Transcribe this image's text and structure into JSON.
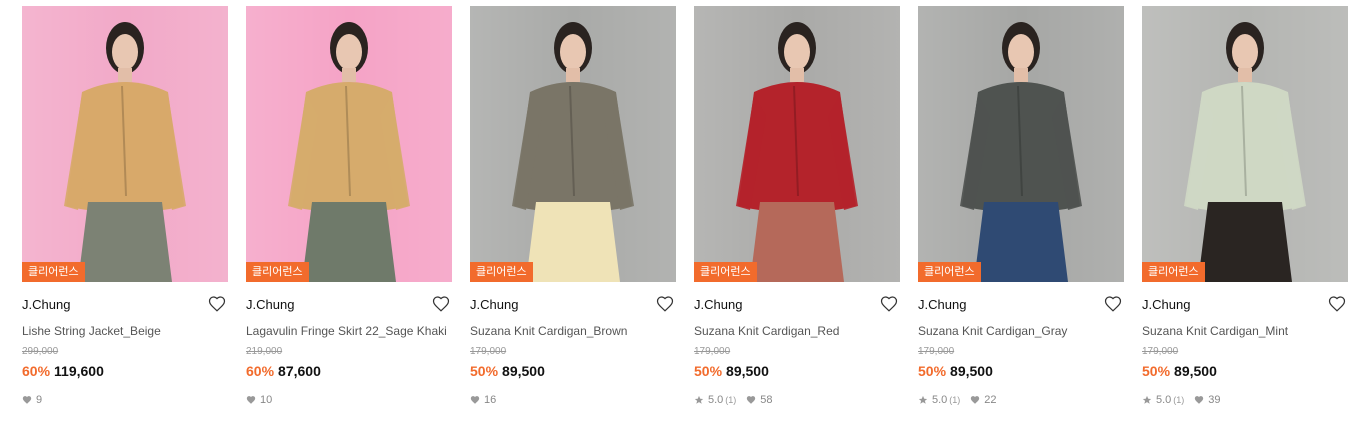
{
  "products": [
    {
      "badge": "클리어런스",
      "brand": "J.Chung",
      "name": "Lishe String Jacket_Beige",
      "original_price": "299,000",
      "discount": "60%",
      "price": "119,600",
      "rating": "",
      "review_count": "",
      "likes": "9",
      "colors": {
        "bg": "#f2a9c8",
        "top": "#d8a96a",
        "bottom": "#7c8274"
      }
    },
    {
      "badge": "클리어런스",
      "brand": "J.Chung",
      "name": "Lagavulin Fringe Skirt 22_Sage Khaki",
      "original_price": "219,000",
      "discount": "60%",
      "price": "87,600",
      "rating": "",
      "review_count": "",
      "likes": "10",
      "colors": {
        "bg": "#f5a3c6",
        "top": "#d6ab6c",
        "bottom": "#6f7a6a"
      }
    },
    {
      "badge": "클리어런스",
      "brand": "J.Chung",
      "name": "Suzana Knit Cardigan_Brown",
      "original_price": "179,000",
      "discount": "50%",
      "price": "89,500",
      "rating": "",
      "review_count": "",
      "likes": "16",
      "colors": {
        "bg": "#a9aaa8",
        "top": "#7a7567",
        "bottom": "#efe3b7"
      }
    },
    {
      "badge": "클리어런스",
      "brand": "J.Chung",
      "name": "Suzana Knit Cardigan_Red",
      "original_price": "179,000",
      "discount": "50%",
      "price": "89,500",
      "rating": "5.0",
      "review_count": "(1)",
      "likes": "58",
      "colors": {
        "bg": "#aaaaa8",
        "top": "#b4232b",
        "bottom": "#b5695a"
      }
    },
    {
      "badge": "클리어런스",
      "brand": "J.Chung",
      "name": "Suzana Knit Cardigan_Gray",
      "original_price": "179,000",
      "discount": "50%",
      "price": "89,500",
      "rating": "5.0",
      "review_count": "(1)",
      "likes": "22",
      "colors": {
        "bg": "#a6a7a5",
        "top": "#4f5350",
        "bottom": "#2f4a73"
      }
    },
    {
      "badge": "클리어런스",
      "brand": "J.Chung",
      "name": "Suzana Knit Cardigan_Mint",
      "original_price": "179,000",
      "discount": "50%",
      "price": "89,500",
      "rating": "5.0",
      "review_count": "(1)",
      "likes": "39",
      "colors": {
        "bg": "#b4b5b2",
        "top": "#cfd8c4",
        "bottom": "#2a2522"
      }
    }
  ],
  "icons": {
    "wishlist": "heart-outline-icon",
    "likes": "heart-filled-icon",
    "rating": "star-icon"
  },
  "accent_color": "#f26b2c"
}
